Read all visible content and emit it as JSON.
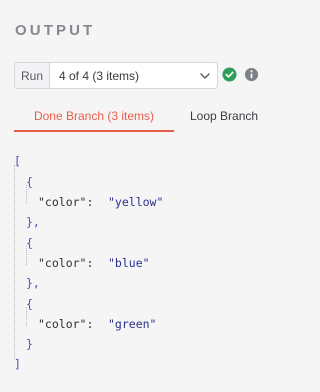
{
  "panel": {
    "title": "OUTPUT"
  },
  "run_selector": {
    "label": "Run",
    "selected": "4 of 4 (3 items)"
  },
  "status": {
    "color": "#2e9e5b"
  },
  "tabs": [
    {
      "label": "Done Branch (3 items)",
      "active": true
    },
    {
      "label": "Loop Branch",
      "active": false
    }
  ],
  "json": {
    "open": "[",
    "close": "]",
    "obj_open": "{",
    "obj_close": "}",
    "obj_close_comma": "},",
    "key": "\"color\":",
    "items": [
      {
        "value": "\"yellow\""
      },
      {
        "value": "\"blue\""
      },
      {
        "value": "\"green\""
      }
    ]
  },
  "colors": {
    "accent": "#e85d48",
    "title": "#85888d",
    "background": "#f5f5f6"
  }
}
